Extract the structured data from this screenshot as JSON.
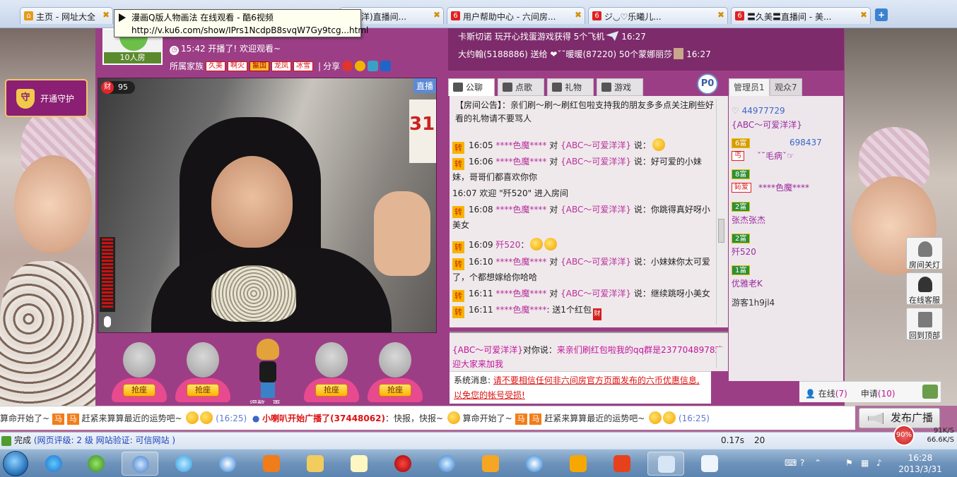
{
  "browser": {
    "tabs": [
      {
        "label": "主页 - 网址大全",
        "icon": "home-icon"
      },
      {
        "label": "洋)直播间...",
        "icon": "six-room-icon"
      },
      {
        "label": "用户帮助中心 - 六间房...",
        "icon": "six-room-icon"
      },
      {
        "label": "ジ◡♡乐曦儿...",
        "icon": "six-room-icon"
      },
      {
        "label": "〓久美〓直播间 - 美...",
        "icon": "six-room-icon"
      }
    ],
    "tooltip_title": "漫画Q版人物画法 在线观看 - 酷6视频",
    "tooltip_url": "http://v.ku6.com/show/IPrs1NcdpB8svqW7Gy9tcg...html",
    "status": {
      "done": "完成",
      "rating": "(网页评级: 2 级 网站验证: 可信网站 )",
      "latency": "0.17s",
      "count": "20",
      "speed_percent": "90%",
      "upload": "91K/S",
      "download": "66.6K/S"
    }
  },
  "room": {
    "room_size": "10人房",
    "start_text": "15:42 开播了! 欢迎观看~",
    "family_label": "所属家族",
    "families": [
      "久美",
      "啊火",
      "鬣国",
      "龙凤",
      "冰雪"
    ],
    "share_label": "分享",
    "guard_label": "开通守护",
    "wealth": "95",
    "wealth_icon_text": "财",
    "live_tag": "直播",
    "seat_label": "抢座",
    "host_name": "得懿...更"
  },
  "feed": [
    {
      "text": "卡斯切诺 玩开心找蛋游戏获得 5个飞机",
      "time": "16:27"
    },
    {
      "text": "大约翰(5188886) 送给 ❤ˇ˘暖暖(87220) 50个蒙娜丽莎",
      "time": "16:27"
    }
  ],
  "chat": {
    "tabs": [
      "公聊",
      "点歌",
      "礼物",
      "游戏"
    ],
    "p_button": "P0",
    "announcement": "【房间公告】：亲们刷～刷～刷红包啦支持我的朋友多多点关注刷些好看的礼物请不要骂人",
    "zhuan": "转",
    "messages": [
      {
        "time": "16:05",
        "user": "****色魔****",
        "to": "对",
        "target": "{ABC～可爱洋洋}",
        "say": "说：",
        "text": ""
      },
      {
        "time": "16:06",
        "user": "****色魔****",
        "to": "对",
        "target": "{ABC～可爱洋洋}",
        "say": "说：",
        "text": "好可爱的小妹妹，哥哥们都喜欢你你"
      },
      {
        "time": "16:07",
        "user": "",
        "to": "",
        "target": "",
        "say": "",
        "text": "欢迎 \"歼520\" 进入房间"
      },
      {
        "time": "16:08",
        "user": "****色魔****",
        "to": "对",
        "target": "{ABC～可爱洋洋}",
        "say": "说：",
        "text": "你跳得真好呀小美女"
      },
      {
        "time": "16:09",
        "user": "歼520",
        "to": "",
        "target": "",
        "say": "：",
        "text": ""
      },
      {
        "time": "16:10",
        "user": "****色魔****",
        "to": "对",
        "target": "{ABC～可爱洋洋}",
        "say": "说：",
        "text": "小妹妹你太可爱了，个都想嫁给你哈哈"
      },
      {
        "time": "16:11",
        "user": "****色魔****",
        "to": "对",
        "target": "{ABC～可爱洋洋}",
        "say": "说：",
        "text": "继续跳呀小美女"
      },
      {
        "time": "16:11",
        "user": "****色魔****",
        "to": "",
        "target": "",
        "say": ":",
        "text": "送1个红包"
      }
    ],
    "private_from": "{ABC～可爱洋洋}",
    "private_to": "对你说：",
    "private_text": "来亲们刷红包啦我的qq群是2377048978欢迎大家来加我",
    "system_label": "系统消息:",
    "system_text": "请不要相信任何非六间房官方页面发布的六币优惠信息,以免您的帐号受损!"
  },
  "users": {
    "tabs": [
      "管理员1",
      "观众7"
    ],
    "list": [
      {
        "id": "44977729",
        "name": "{ABC～可爱洋洋}",
        "level": "",
        "badge": ""
      },
      {
        "id": "698437",
        "name": "ˇ˘毛病ˇ☞",
        "level": "6富",
        "badge": "丐"
      },
      {
        "id": "",
        "name": "****色魔****",
        "level": "8富",
        "badge": "鈊爱"
      },
      {
        "id": "",
        "name": "张杰张杰",
        "level": "2富",
        "badge": ""
      },
      {
        "id": "",
        "name": "歼520",
        "level": "2富",
        "badge": ""
      },
      {
        "id": "",
        "name": "优雅老K",
        "level": "1富",
        "badge": ""
      }
    ],
    "guest": "游客1h9jl4",
    "online_label": "在线",
    "online_count": "(7)",
    "apply_label": "申请",
    "apply_count": "(10)"
  },
  "side_tools": [
    "房间关灯",
    "在线客服",
    "回到顶部"
  ],
  "marquee": {
    "part1": "算命开始了~",
    "horse": "马",
    "part2": "赶紧来算算最近的运势吧~",
    "time1": "(16:25)",
    "bullet": "小喇叭开始广播了(37448062)",
    "part3": "：快报，快报~",
    "part4": "算命开始了~",
    "part5": "赶紧来算算最近的运势吧~",
    "time2": "(16:25)"
  },
  "broadcast_label": "发布广播",
  "taskbar": {
    "time": "16:28",
    "date": "2013/3/31"
  },
  "colors": {
    "page_purple": "#9c3e86",
    "accent_magenta": "#b8309a",
    "alert_red": "#d11"
  }
}
